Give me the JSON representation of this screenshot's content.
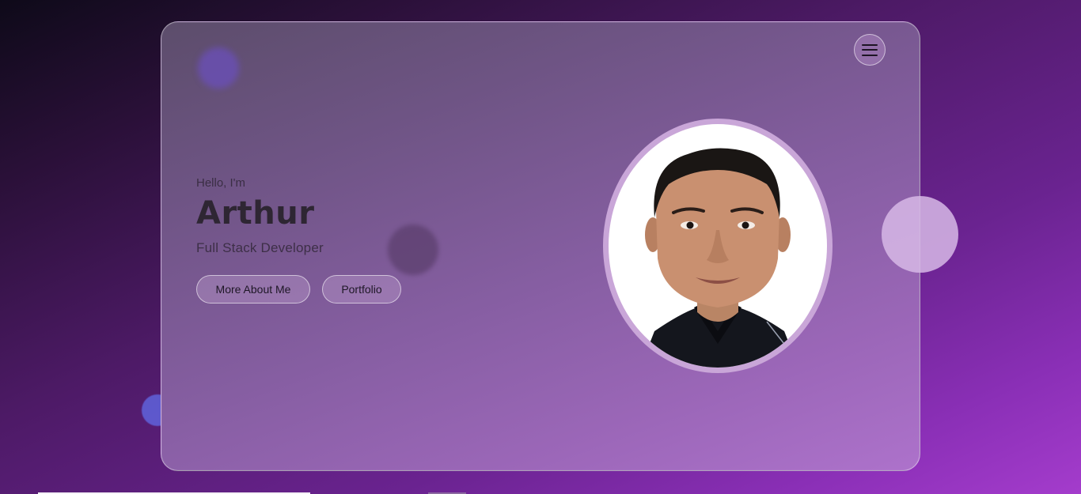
{
  "header": {
    "menu_icon": "hamburger-menu-icon"
  },
  "hero": {
    "greeting": "Hello, I'm",
    "name": "Arthur",
    "role": "Full Stack Developer",
    "buttons": {
      "about": "More About Me",
      "portfolio": "Portfolio"
    }
  },
  "profile_photo": {
    "icon": "profile-photo"
  },
  "colors": {
    "background_start": "#0e0a19",
    "background_end": "#a43ccc",
    "card_tint": "#865ea2",
    "text_dark": "#2e2633"
  }
}
